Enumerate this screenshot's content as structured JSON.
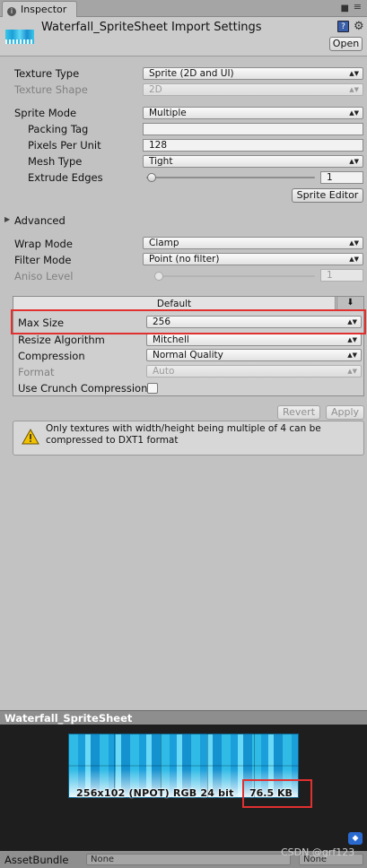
{
  "window": {
    "tab_label": "Inspector",
    "tab_icon": "i",
    "lock_glyph": "■",
    "menu_glyph": "≡"
  },
  "header": {
    "title": "Waterfall_SpriteSheet Import Settings",
    "open_label": "Open",
    "help_glyph": "?",
    "gear_glyph": "⚙"
  },
  "importer": {
    "texture_type": {
      "label": "Texture Type",
      "value": "Sprite (2D and UI)"
    },
    "texture_shape": {
      "label": "Texture Shape",
      "value": "2D"
    },
    "sprite_mode": {
      "label": "Sprite Mode",
      "value": "Multiple"
    },
    "packing_tag": {
      "label": "Packing Tag",
      "value": ""
    },
    "pixels_per_unit": {
      "label": "Pixels Per Unit",
      "value": "128"
    },
    "mesh_type": {
      "label": "Mesh Type",
      "value": "Tight"
    },
    "extrude_edges": {
      "label": "Extrude Edges",
      "value": "1"
    },
    "sprite_editor_label": "Sprite Editor",
    "advanced_label": "Advanced",
    "wrap_mode": {
      "label": "Wrap Mode",
      "value": "Clamp"
    },
    "filter_mode": {
      "label": "Filter Mode",
      "value": "Point (no filter)"
    },
    "aniso_level": {
      "label": "Aniso Level",
      "value": "1"
    }
  },
  "platform": {
    "tab_label": "Default",
    "download_glyph": "⬇",
    "max_size": {
      "label": "Max Size",
      "value": "256"
    },
    "resize_algorithm": {
      "label": "Resize Algorithm",
      "value": "Mitchell"
    },
    "compression": {
      "label": "Compression",
      "value": "Normal Quality"
    },
    "format": {
      "label": "Format",
      "value": "Auto"
    },
    "use_crunch": {
      "label": "Use Crunch Compression",
      "checked": false
    }
  },
  "actions": {
    "revert_label": "Revert",
    "apply_label": "Apply"
  },
  "warning": {
    "text": "Only textures with width/height being multiple of 4 can be compressed to DXT1 format"
  },
  "preview": {
    "title": "Waterfall_SpriteSheet",
    "info": "256x102 (NPOT)  RGB 24 bit",
    "size": "76.5 KB",
    "tag_glyph": "◆"
  },
  "asset_bundle": {
    "label": "AssetBundle",
    "name_value": "None",
    "variant_value": "None"
  },
  "watermark": "CSDN @grf123",
  "colors": {
    "highlight": "#e03030",
    "panel": "#c2c2c2",
    "preview_bg": "#1e1e1e"
  }
}
